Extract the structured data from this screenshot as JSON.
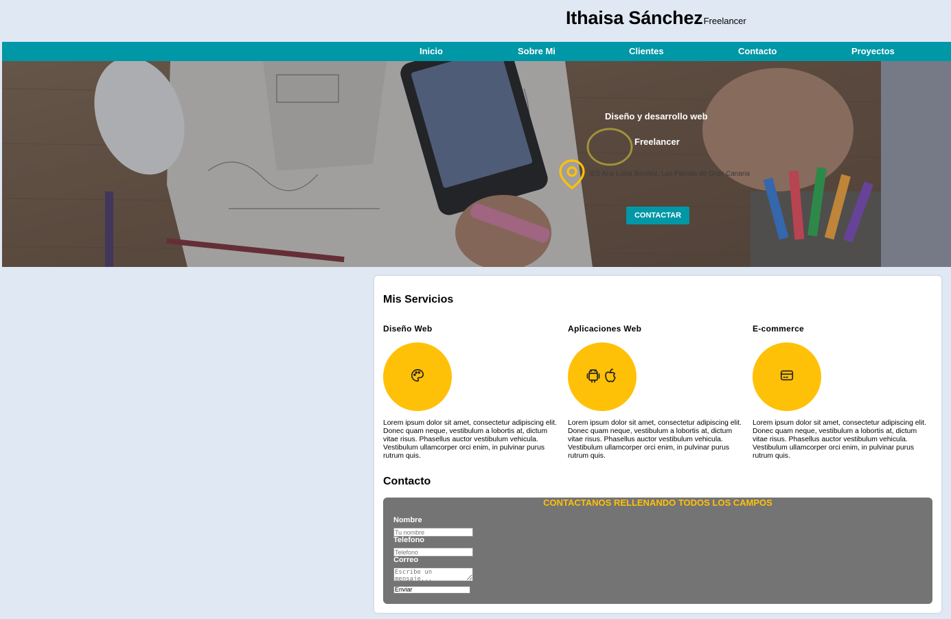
{
  "header": {
    "name": "Ithaisa Sánchez",
    "role": "Freelancer"
  },
  "nav": {
    "items": [
      "Inicio",
      "Sobre Mi",
      "Clientes",
      "Contacto",
      "Proyectos"
    ],
    "color": "#0097a7"
  },
  "hero": {
    "title": "Diseño y desarrollo web",
    "subtitle": "Freelancer",
    "location": "IES Ana Luisa Benítez, Las Palmas de Gran Canaria",
    "location_icon": "map-pin-icon",
    "button": "CONTACTAR"
  },
  "services": {
    "heading": "Mis Servicios",
    "items": [
      {
        "title": "Diseño Web",
        "icon": "palette-icon",
        "description": "Lorem ipsum dolor sit amet, consectetur adipiscing elit. Donec quam neque, vestibulum a lobortis at, dictum vitae risus. Phasellus auctor vestibulum vehicula. Vestibulum ullamcorper orci enim, in pulvinar purus rutrum quis."
      },
      {
        "title": "Aplicaciones Web",
        "icon": "android-apple-icon",
        "description": "Lorem ipsum dolor sit amet, consectetur adipiscing elit. Donec quam neque, vestibulum a lobortis at, dictum vitae risus. Phasellus auctor vestibulum vehicula. Vestibulum ullamcorper orci enim, in pulvinar purus rutrum quis."
      },
      {
        "title": "E-commerce",
        "icon": "credit-card-icon",
        "description": "Lorem ipsum dolor sit amet, consectetur adipiscing elit. Donec quam neque, vestibulum a lobortis at, dictum vitae risus. Phasellus auctor vestibulum vehicula. Vestibulum ullamcorper orci enim, in pulvinar purus rutrum quis."
      }
    ],
    "accent": "#ffc107"
  },
  "contact": {
    "heading": "Contacto",
    "form_heading": "CONTACTANOS RELLENANDO TODOS LOS CAMPOS",
    "name_label": "Nombre",
    "name_placeholder": "Tu nombre",
    "phone_label": "Telefono",
    "phone_placeholder": "Telefono",
    "email_label": "Correo",
    "message_placeholder": "Escribe un mensaje...",
    "submit": "Enviar"
  }
}
